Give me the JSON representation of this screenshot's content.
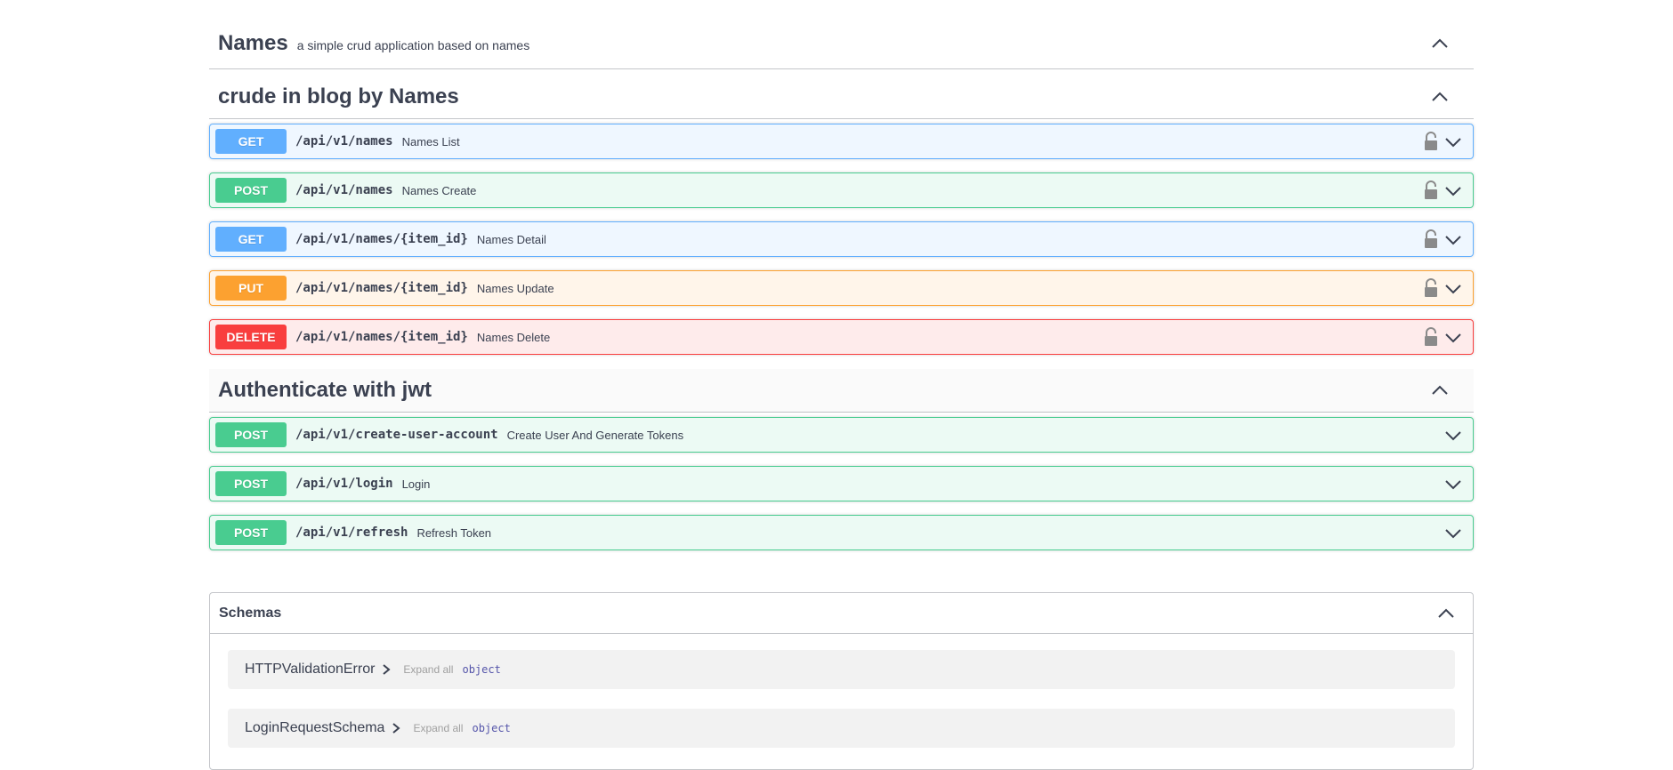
{
  "header": {
    "title": "Names",
    "description": "a simple crud application based on names"
  },
  "groups": [
    {
      "title": "crude in blog by Names",
      "operations": [
        {
          "method": "GET",
          "path": "/api/v1/names",
          "summary": "Names List",
          "locked": true
        },
        {
          "method": "POST",
          "path": "/api/v1/names",
          "summary": "Names Create",
          "locked": true
        },
        {
          "method": "GET",
          "path": "/api/v1/names/{item_id}",
          "summary": "Names Detail",
          "locked": true
        },
        {
          "method": "PUT",
          "path": "/api/v1/names/{item_id}",
          "summary": "Names Update",
          "locked": true
        },
        {
          "method": "DELETE",
          "path": "/api/v1/names/{item_id}",
          "summary": "Names Delete",
          "locked": true
        }
      ]
    },
    {
      "title": "Authenticate with jwt",
      "operations": [
        {
          "method": "POST",
          "path": "/api/v1/create-user-account",
          "summary": "Create User And Generate Tokens",
          "locked": false
        },
        {
          "method": "POST",
          "path": "/api/v1/login",
          "summary": "Login",
          "locked": false
        },
        {
          "method": "POST",
          "path": "/api/v1/refresh",
          "summary": "Refresh Token",
          "locked": false
        }
      ]
    }
  ],
  "schemas": {
    "title": "Schemas",
    "models": [
      {
        "name": "HTTPValidationError",
        "expand_label": "Expand all",
        "type": "object"
      },
      {
        "name": "LoginRequestSchema",
        "expand_label": "Expand all",
        "type": "object"
      }
    ]
  },
  "colors": {
    "get": "#61affe",
    "post": "#49cc90",
    "put": "#fca130",
    "delete": "#f93e3e",
    "text": "#3b4151"
  }
}
